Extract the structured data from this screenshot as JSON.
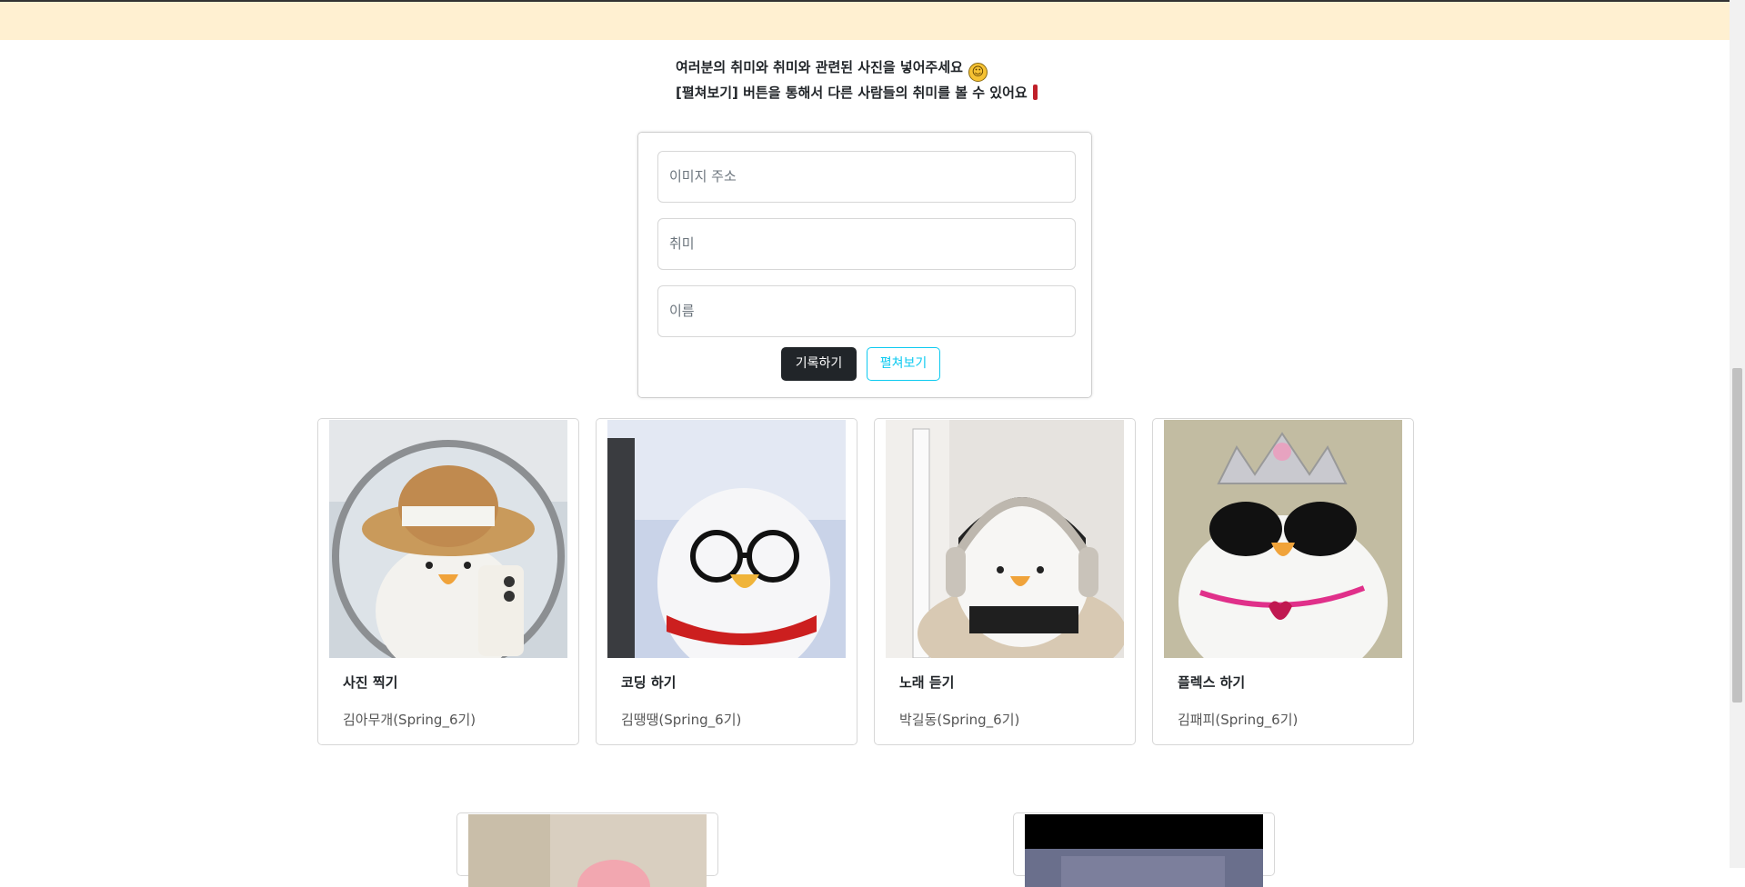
{
  "intro": {
    "line1": "여러분의 취미와 취미와 관련된 사진을 넣어주세요",
    "line2": "[펼쳐보기] 버튼을 통해서 다른 사람들의 취미를 볼 수 있어요"
  },
  "form": {
    "image_placeholder": "이미지 주소",
    "hobby_placeholder": "취미",
    "name_placeholder": "이름",
    "save_label": "기록하기",
    "open_label": "펼쳐보기"
  },
  "cards": [
    {
      "title": "사진 찍기",
      "author": "김아무개(Spring_6기)"
    },
    {
      "title": "코딩 하기",
      "author": "김땡땡(Spring_6기)"
    },
    {
      "title": "노래 듣기",
      "author": "박길동(Spring_6기)"
    },
    {
      "title": "플렉스 하기",
      "author": "김패피(Spring_6기)"
    }
  ],
  "colors": {
    "topbar": "#fff0d1",
    "primary_button": "#212529",
    "info_button": "#0dcaf0"
  }
}
